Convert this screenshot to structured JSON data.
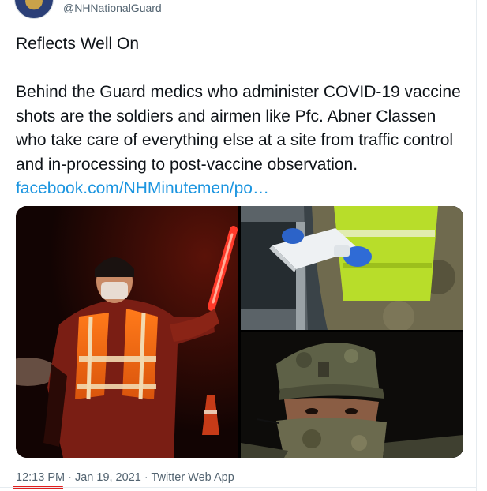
{
  "tweet": {
    "handle": "@NHNationalGuard",
    "title": "Reflects Well On",
    "body_text": "Behind the Guard medics who administer COVID-19 vaccine shots are the soldiers and airmen like Pfc. Abner Classen who take care of everything else at a site from traffic control and in-processing to post-vaccine observation.",
    "link_text": "facebook.com/NHMinutemen/po…",
    "time": "12:13 PM",
    "separator": " · ",
    "date": "Jan 19, 2021",
    "source": "Twitter Web App"
  },
  "colors": {
    "link": "#1b95e0",
    "meta_text": "#536471",
    "annotation_underline": "#e01e1e"
  },
  "icons": [
    "avatar-image"
  ]
}
